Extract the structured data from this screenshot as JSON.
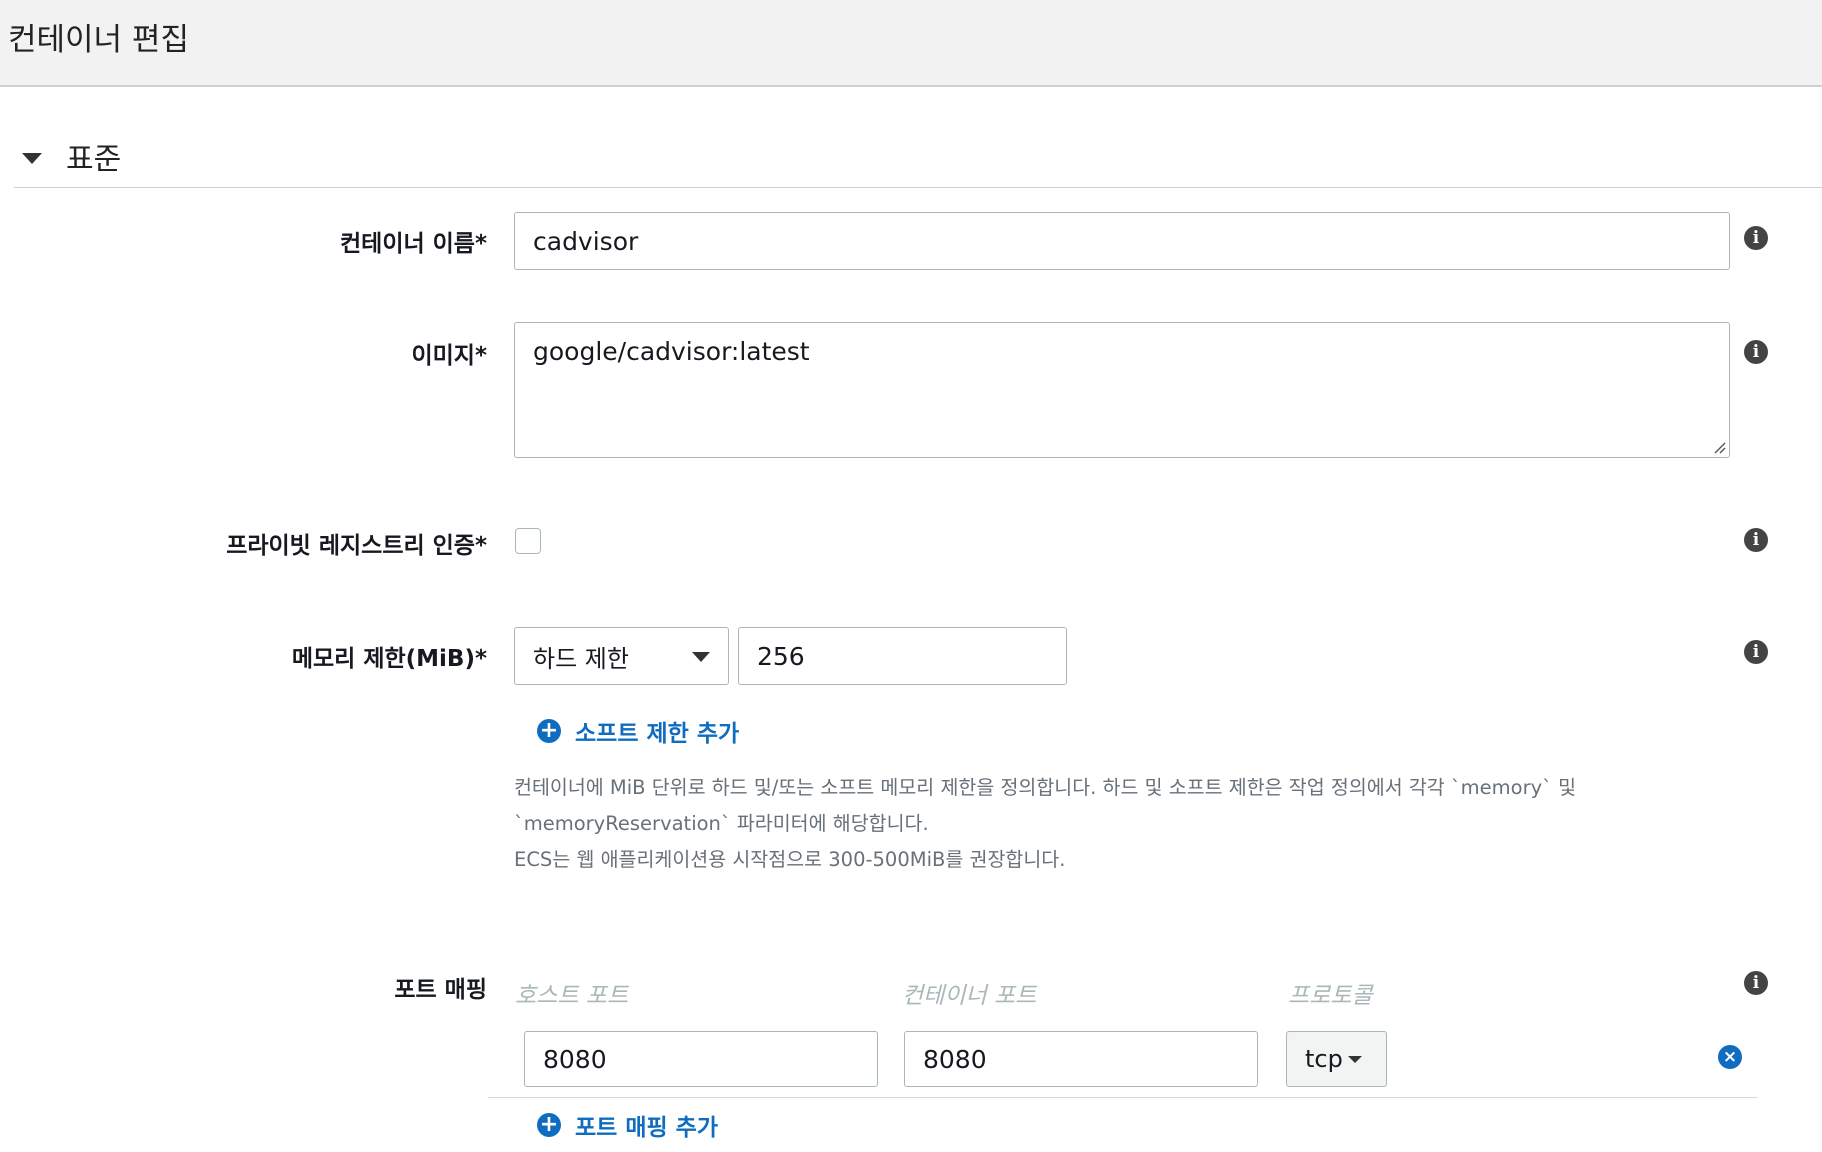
{
  "header": {
    "title": "컨테이너 편집"
  },
  "section": {
    "title": "표준"
  },
  "container_name": {
    "label": "컨테이너 이름*",
    "value": "cadvisor"
  },
  "image": {
    "label": "이미지*",
    "value": "google/cadvisor:latest"
  },
  "private_registry": {
    "label": "프라이빗 레지스트리 인증*",
    "checked": false
  },
  "memory": {
    "label": "메모리 제한(MiB)*",
    "limit_type": "하드 제한",
    "value": "256",
    "add_soft_limit": "소프트 제한 추가",
    "help": [
      "컨테이너에 MiB 단위로 하드 및/또는 소프트 메모리 제한을 정의합니다. 하드 및 소프트 제한은 작업 정의에서 각각 `memory` 및",
      "`memoryReservation` 파라미터에 해당합니다.",
      "ECS는 웹 애플리케이션용 시작점으로 300-500MiB를 권장합니다."
    ]
  },
  "port_mapping": {
    "label": "포트 매핑",
    "columns": {
      "host_port": "호스트 포트",
      "container_port": "컨테이너 포트",
      "protocol": "프로토콜"
    },
    "rows": [
      {
        "host_port": "8080",
        "container_port": "8080",
        "protocol": "tcp"
      }
    ],
    "add_label": "포트 매핑 추가"
  },
  "icons": {
    "info": "i",
    "plus": "+",
    "remove": "×"
  },
  "colors": {
    "link": "#0f6cbf",
    "header_bg": "#f2f2f2"
  }
}
